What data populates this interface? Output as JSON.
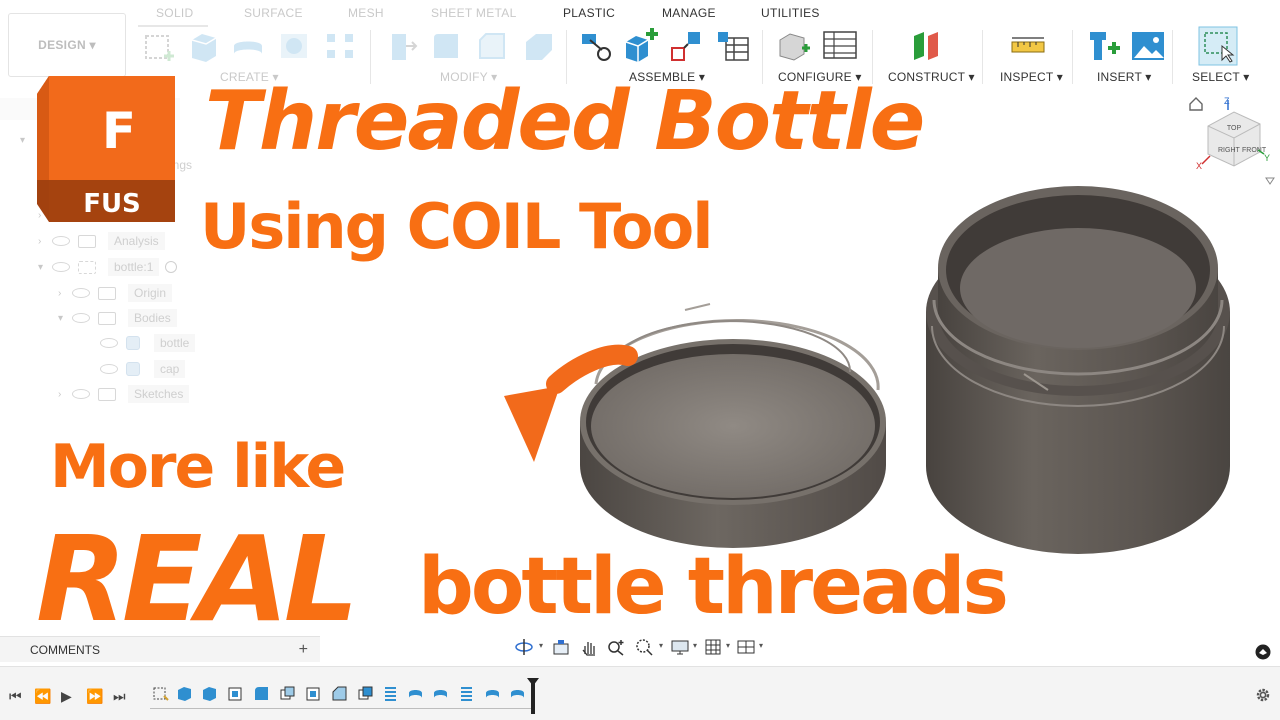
{
  "toolbar": {
    "design_label": "DESIGN ▾",
    "tabs": [
      "SOLID",
      "SURFACE",
      "MESH",
      "SHEET METAL",
      "PLASTIC",
      "MANAGE",
      "UTILITIES"
    ],
    "groups": {
      "create": "CREATE ▾",
      "modify": "MODIFY ▾",
      "assemble": "ASSEMBLE ▾",
      "configure": "CONFIGURE ▾",
      "construct": "CONSTRUCT ▾",
      "inspect": "INSPECT ▾",
      "insert": "INSERT ▾",
      "select": "SELECT ▾"
    }
  },
  "browser": {
    "items": [
      {
        "label": "ings"
      },
      {
        "label": "Analysis"
      },
      {
        "label": "bottle:1"
      },
      {
        "label": "Origin"
      },
      {
        "label": "Bodies"
      },
      {
        "label": "bottle"
      },
      {
        "label": "cap"
      },
      {
        "label": "Sketches"
      }
    ]
  },
  "logo": {
    "letter": "F",
    "text": "FUS"
  },
  "headline": {
    "title": "Threaded Bottle",
    "subtitle": "Using COIL Tool",
    "line1": "More like",
    "line2a": "REAL",
    "line2b": "bottle threads"
  },
  "viewcube": {
    "faces": [
      "TOP",
      "RIGHT",
      "FRONT"
    ],
    "axes": [
      "Z",
      "X",
      "Y"
    ]
  },
  "comments": {
    "label": "COMMENTS",
    "add": "+"
  },
  "colors": {
    "accent": "#f86f13",
    "model": "#5f5954",
    "panel": "#f4f4f4",
    "select_blue": "#2f8fd0"
  }
}
